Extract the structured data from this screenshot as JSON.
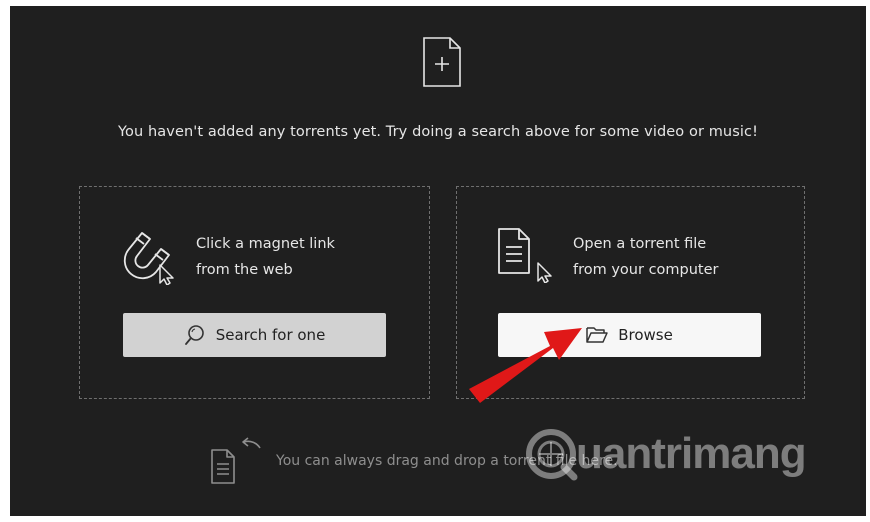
{
  "empty_state": {
    "message": "You haven't added any torrents yet. Try doing a search above for some video or music!"
  },
  "magnet_card": {
    "line1": "Click a magnet link",
    "line2": "from the web",
    "button_label": "Search for one",
    "icons": [
      "magnet-icon",
      "cursor-icon",
      "search-icon"
    ]
  },
  "file_card": {
    "line1": "Open a torrent file",
    "line2": "from your computer",
    "button_label": "Browse",
    "icons": [
      "document-icon",
      "cursor-icon",
      "folder-open-icon"
    ]
  },
  "drag_hint": {
    "text": "You can always drag and drop a torrent file here."
  },
  "watermark": {
    "text": "uantrimang"
  },
  "colors": {
    "panel_bg": "#1f1f1f",
    "text": "#e6e6e6",
    "muted": "#8e8e8e",
    "search_button_bg": "#d2d2d2",
    "browse_button_bg": "#f7f7f7",
    "annotation_arrow": "#e01818"
  }
}
